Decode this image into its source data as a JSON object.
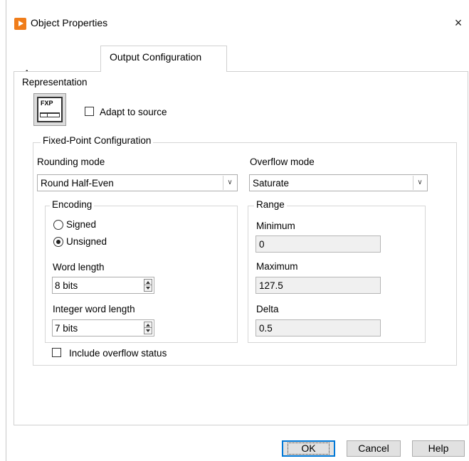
{
  "window": {
    "title": "Object Properties",
    "close_glyph": "×",
    "icon": "labview-app-icon"
  },
  "tabs": [
    {
      "label": "Appearance",
      "active": false
    },
    {
      "label": "Output Configuration",
      "active": true
    }
  ],
  "representation": {
    "label": "Representation",
    "icon_text": "FXP",
    "adapt_label": "Adapt to source",
    "adapt_checked": false
  },
  "fixed_point": {
    "legend": "Fixed-Point Configuration",
    "rounding_label": "Rounding mode",
    "rounding_value": "Round Half-Even",
    "overflow_label": "Overflow mode",
    "overflow_value": "Saturate",
    "encoding": {
      "legend": "Encoding",
      "signed_label": "Signed",
      "unsigned_label": "Unsigned",
      "selected": "Unsigned",
      "word_length_label": "Word length",
      "word_length_value": "8 bits",
      "int_word_length_label": "Integer word length",
      "int_word_length_value": "7 bits"
    },
    "range": {
      "legend": "Range",
      "minimum_label": "Minimum",
      "minimum_value": "0",
      "maximum_label": "Maximum",
      "maximum_value": "127.5",
      "delta_label": "Delta",
      "delta_value": "0.5"
    },
    "overflow_status_label": "Include overflow status",
    "overflow_status_checked": false
  },
  "footer": {
    "ok_label": "OK",
    "cancel_label": "Cancel",
    "help_label": "Help"
  }
}
